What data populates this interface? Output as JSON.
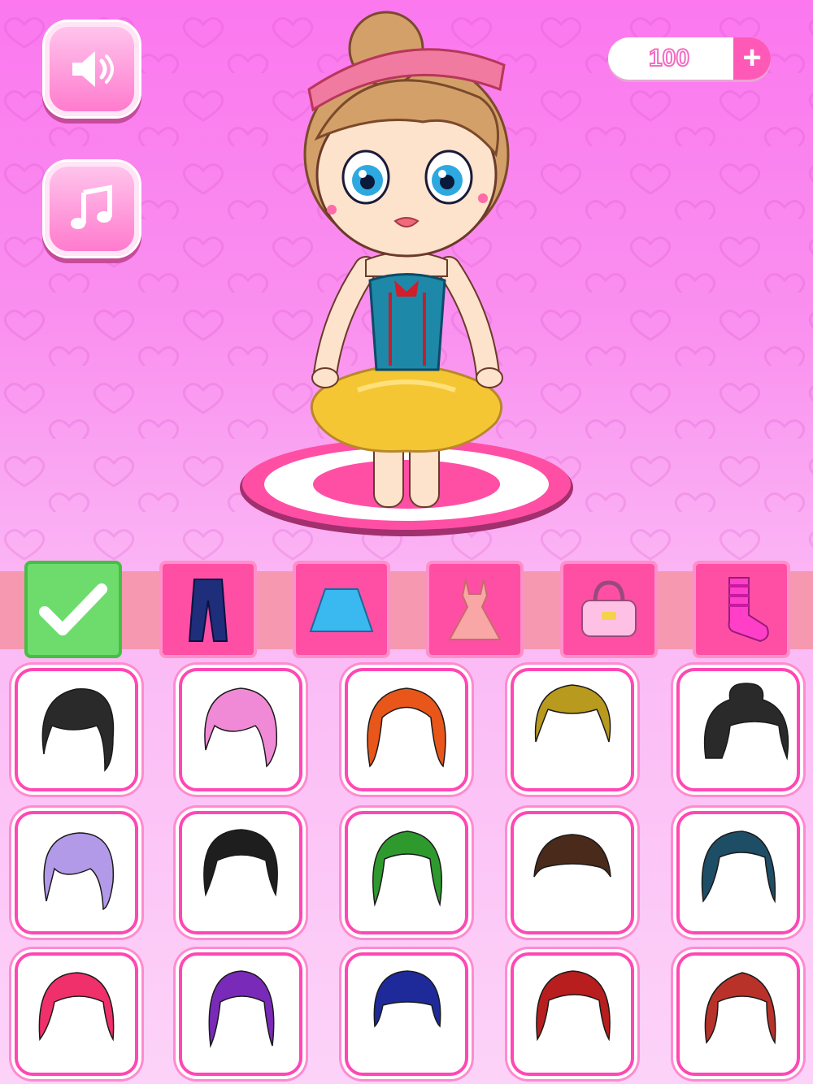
{
  "hud": {
    "coins": "100",
    "plus_label": "+"
  },
  "categories": [
    {
      "id": "done",
      "icon": "checkmark-icon",
      "active": true
    },
    {
      "id": "pants",
      "icon": "pants-icon",
      "active": false
    },
    {
      "id": "skirt",
      "icon": "skirt-icon",
      "active": false
    },
    {
      "id": "dress",
      "icon": "dress-icon",
      "active": false
    },
    {
      "id": "bag",
      "icon": "handbag-icon",
      "active": false
    },
    {
      "id": "socks",
      "icon": "sock-icon",
      "active": false
    }
  ],
  "hairstyles": [
    {
      "icon": "hair-black-bob-icon",
      "color": "#2a2a2a"
    },
    {
      "icon": "hair-pink-bob-icon",
      "color": "#f08ad6"
    },
    {
      "icon": "hair-orange-long-icon",
      "color": "#e8561a"
    },
    {
      "icon": "hair-blonde-bob-icon",
      "color": "#b89a1e"
    },
    {
      "icon": "hair-black-bun-icon",
      "color": "#2a2a2a"
    },
    {
      "icon": "hair-lilac-bob-icon",
      "color": "#b39ae8"
    },
    {
      "icon": "hair-black-curly-icon",
      "color": "#1e1e1e"
    },
    {
      "icon": "hair-green-wavy-icon",
      "color": "#2e9a2e"
    },
    {
      "icon": "hair-brown-pigtails-icon",
      "color": "#4a2a1a"
    },
    {
      "icon": "hair-teal-long-icon",
      "color": "#1e4d66"
    },
    {
      "icon": "hair-pink-shag-icon",
      "color": "#f0306a"
    },
    {
      "icon": "hair-purple-long-icon",
      "color": "#7a2ab8"
    },
    {
      "icon": "hair-navy-bangs-icon",
      "color": "#1e2a9a"
    },
    {
      "icon": "hair-red-bob-icon",
      "color": "#b81e1e"
    },
    {
      "icon": "hair-red-quiff-icon",
      "color": "#b8322a"
    }
  ],
  "colors": {
    "accent": "#ff4fa5",
    "active_tab": "#6ddc6d"
  }
}
